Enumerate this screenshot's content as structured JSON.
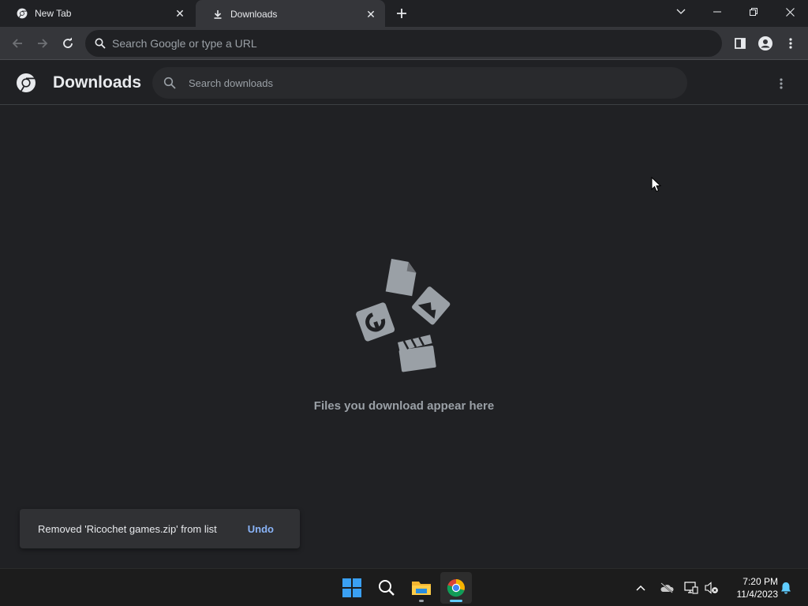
{
  "tabs": [
    {
      "label": "New Tab",
      "icon": "chrome-icon",
      "active": false
    },
    {
      "label": "Downloads",
      "icon": "download-icon",
      "active": true
    }
  ],
  "toolbar": {
    "omnibox_placeholder": "Search Google or type a URL"
  },
  "downloads": {
    "title": "Downloads",
    "search_placeholder": "Search downloads",
    "empty_message": "Files you download appear here"
  },
  "toast": {
    "message": "Removed 'Ricochet games.zip' from list",
    "action": "Undo"
  },
  "taskbar": {
    "apps": [
      "windows-start-icon",
      "search-icon",
      "file-explorer-icon",
      "chrome-icon"
    ],
    "time": "7:20 PM",
    "date": "11/4/2023"
  },
  "colors": {
    "background": "#202124",
    "toolbar": "#35363a",
    "accent": "#8ab4f8",
    "muted_text": "#9aa0a6",
    "taskbar": "#1c1c1c"
  }
}
